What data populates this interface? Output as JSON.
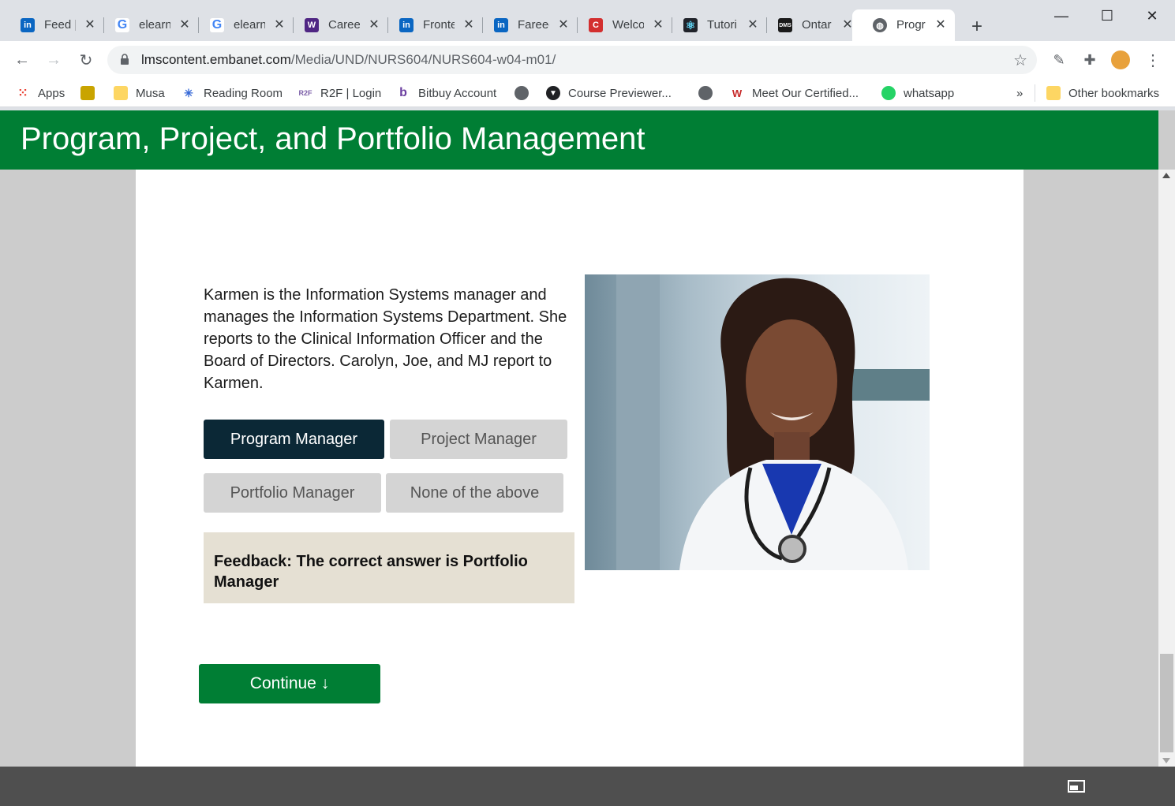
{
  "browser": {
    "tabs": [
      {
        "label": "Feed |",
        "icon": "linkedin-icon"
      },
      {
        "label": "elearn",
        "icon": "google-icon"
      },
      {
        "label": "elearn",
        "icon": "google-icon"
      },
      {
        "label": "Caree",
        "icon": "western-icon"
      },
      {
        "label": "Fronte",
        "icon": "linkedin-icon"
      },
      {
        "label": "Fareed",
        "icon": "linkedin-icon"
      },
      {
        "label": "Welco",
        "icon": "c-icon"
      },
      {
        "label": "Tutori",
        "icon": "react-icon"
      },
      {
        "label": "Ontar",
        "icon": "dms-icon"
      },
      {
        "label": "Progr",
        "icon": "globe-icon"
      }
    ],
    "url_host": "lmscontent.embanet.com",
    "url_path": "/Media/UND/NURS604/NURS604-w04-m01/",
    "bookmarks": [
      {
        "label": "Apps"
      },
      {
        "label": ""
      },
      {
        "label": "Musa"
      },
      {
        "label": "Reading Room"
      },
      {
        "label": "R2F | Login"
      },
      {
        "label": "Bitbuy Account"
      },
      {
        "label": ""
      },
      {
        "label": "Course Previewer..."
      },
      {
        "label": ""
      },
      {
        "label": "Meet Our Certified..."
      },
      {
        "label": "whatsapp"
      }
    ],
    "overflow": "»",
    "other_bookmarks": "Other bookmarks"
  },
  "course": {
    "title": "Program, Project, and Portfolio Management",
    "scenario": "Karmen is the Information Systems manager and manages the Information Systems Department. She reports to the Clinical Information Officer and the Board of Directors. Carolyn, Joe, and MJ report to Karmen.",
    "choices": [
      {
        "label": "Program Manager",
        "selected": true
      },
      {
        "label": "Project Manager",
        "selected": false
      },
      {
        "label": "Portfolio Manager",
        "selected": false
      },
      {
        "label": "None of the above",
        "selected": false
      }
    ],
    "feedback": "Feedback: The correct answer is Portfolio Manager",
    "continue_label": "Continue ↓"
  },
  "colors": {
    "brand_green": "#007e34",
    "selected_choice": "#0b2836",
    "feedback_bg": "#e5e0d3"
  }
}
